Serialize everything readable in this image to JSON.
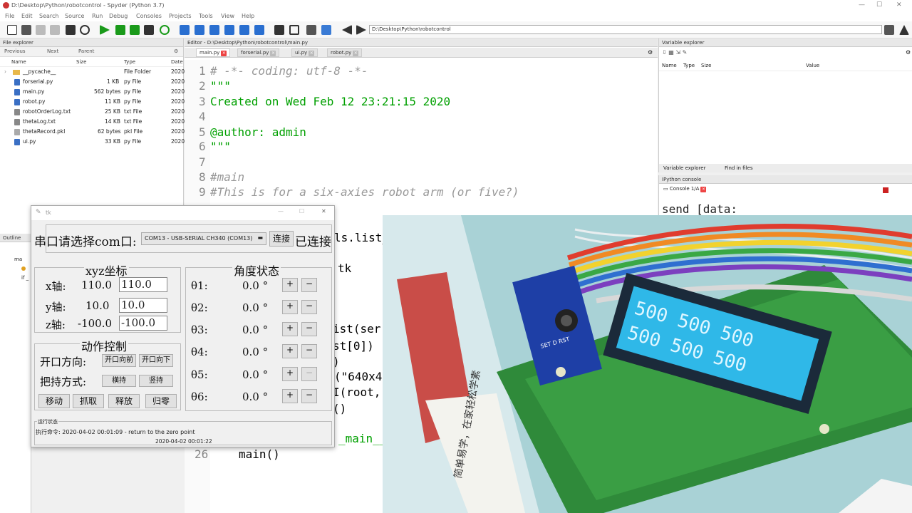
{
  "window": {
    "title": "D:\\Desktop\\Python\\robotcontrol - Spyder (Python 3.7)",
    "controls": {
      "minimize": "—",
      "maximize": "☐",
      "close": "✕"
    }
  },
  "menu": [
    "File",
    "Edit",
    "Search",
    "Source",
    "Run",
    "Debug",
    "Consoles",
    "Projects",
    "Tools",
    "View",
    "Help"
  ],
  "toolbar": {
    "path": "D:\\Desktop\\Python\\robotcontrol"
  },
  "file_explorer": {
    "header": "File explorer",
    "nav": {
      "previous": "Previous",
      "next": "Next",
      "parent": "Parent"
    },
    "columns": {
      "name": "Name",
      "size": "Size",
      "type": "Type",
      "date": "Date"
    },
    "rows": [
      {
        "name": "__pycache__",
        "size": "",
        "type": "File Folder",
        "date": "2020"
      },
      {
        "name": "forserial.py",
        "size": "1 KB",
        "type": "py File",
        "date": "2020"
      },
      {
        "name": "main.py",
        "size": "562 bytes",
        "type": "py File",
        "date": "2020"
      },
      {
        "name": "robot.py",
        "size": "11 KB",
        "type": "py File",
        "date": "2020"
      },
      {
        "name": "robotOrderLog.txt",
        "size": "25 KB",
        "type": "txt File",
        "date": "2020"
      },
      {
        "name": "thetaLog.txt",
        "size": "14 KB",
        "type": "txt File",
        "date": "2020"
      },
      {
        "name": "thetaRecord.pkl",
        "size": "62 bytes",
        "type": "pkl File",
        "date": "2020"
      },
      {
        "name": "ui.py",
        "size": "33 KB",
        "type": "py File",
        "date": "2020"
      }
    ]
  },
  "outline": {
    "header": "Outline",
    "item1": "ma",
    "item2": "if _"
  },
  "editor": {
    "header": "Editor - D:\\Desktop\\Python\\robotcontrol\\main.py",
    "tabs": [
      "main.py",
      "forserial.py",
      "ui.py",
      "robot.py"
    ],
    "lines": [
      {
        "n": "1",
        "text": "# -*- coding: utf-8 -*-",
        "kind": "cmt"
      },
      {
        "n": "2",
        "text": "\"\"\"",
        "kind": "str"
      },
      {
        "n": "3",
        "text": "Created on Wed Feb 12 23:21:15 2020",
        "kind": "str"
      },
      {
        "n": "4",
        "text": "",
        "kind": "str"
      },
      {
        "n": "5",
        "text": "@author: admin",
        "kind": "str"
      },
      {
        "n": "6",
        "text": "\"\"\"",
        "kind": "str"
      },
      {
        "n": "7",
        "text": "",
        "kind": "str"
      },
      {
        "n": "8",
        "text": "#main",
        "kind": "cmt"
      },
      {
        "n": "9",
        "text": "#This is for a six-axies robot arm (or five?)",
        "kind": "cmt"
      }
    ],
    "visible_fragments": [
      "ls.list_",
      "tk",
      "ist(ser",
      "st[0])",
      ")",
      "(\"640x4",
      "I(root,",
      "()",
      "_main__",
      "main()"
    ],
    "last_line_no": "26"
  },
  "variable_explorer": {
    "header": "Variable explorer",
    "columns": {
      "name": "Name",
      "type": "Type",
      "size": "Size",
      "value": "Value"
    },
    "tabs": [
      "Variable explorer",
      "Find in files"
    ]
  },
  "console": {
    "header": "IPython console",
    "tab": "Console 1/A",
    "text": "send [data:"
  },
  "tk_app": {
    "title": "tk",
    "serial": {
      "label": "串口请选择com口:",
      "selected": "COM13 - USB-SERIAL CH340 (COM13)",
      "connect_button": "连接",
      "status": "已连接"
    },
    "xyz": {
      "title": "xyz坐标",
      "axes": [
        {
          "label": "x轴:",
          "value": "110.0",
          "input": "110.0"
        },
        {
          "label": "y轴:",
          "value": "10.0",
          "input": "10.0"
        },
        {
          "label": "z轴:",
          "value": "-100.0",
          "input": "-100.0"
        }
      ]
    },
    "angles": {
      "title": "角度状态",
      "rows": [
        {
          "label": "θ1:",
          "value": "0.0 °"
        },
        {
          "label": "θ2:",
          "value": "0.0 °"
        },
        {
          "label": "θ3:",
          "value": "0.0 °"
        },
        {
          "label": "θ4:",
          "value": "0.0 °"
        },
        {
          "label": "θ5:",
          "value": "0.0 °"
        },
        {
          "label": "θ6:",
          "value": "0.0 °"
        }
      ],
      "plus": "+",
      "minus": "−"
    },
    "action": {
      "title": "动作控制",
      "opening_label": "开口方向:",
      "open_front": "开口向前",
      "open_down": "开口向下",
      "grip_label": "把持方式:",
      "grip_horizontal": "横持",
      "grip_vertical": "竖持",
      "move": "移动",
      "grab": "抓取",
      "release": "释放",
      "home": "归零"
    },
    "status": {
      "title": "运行状态",
      "command": "执行命令: 2020-04-02 00:01:09 - return to the zero point",
      "time": "2020-04-02 00:01:22"
    }
  },
  "camera": {
    "lcd_line1": "500   500   500",
    "lcd_line2": "500   500   500",
    "module_labels": "SET  D  RST",
    "book_text": "简单易学，在家轻松学素"
  }
}
